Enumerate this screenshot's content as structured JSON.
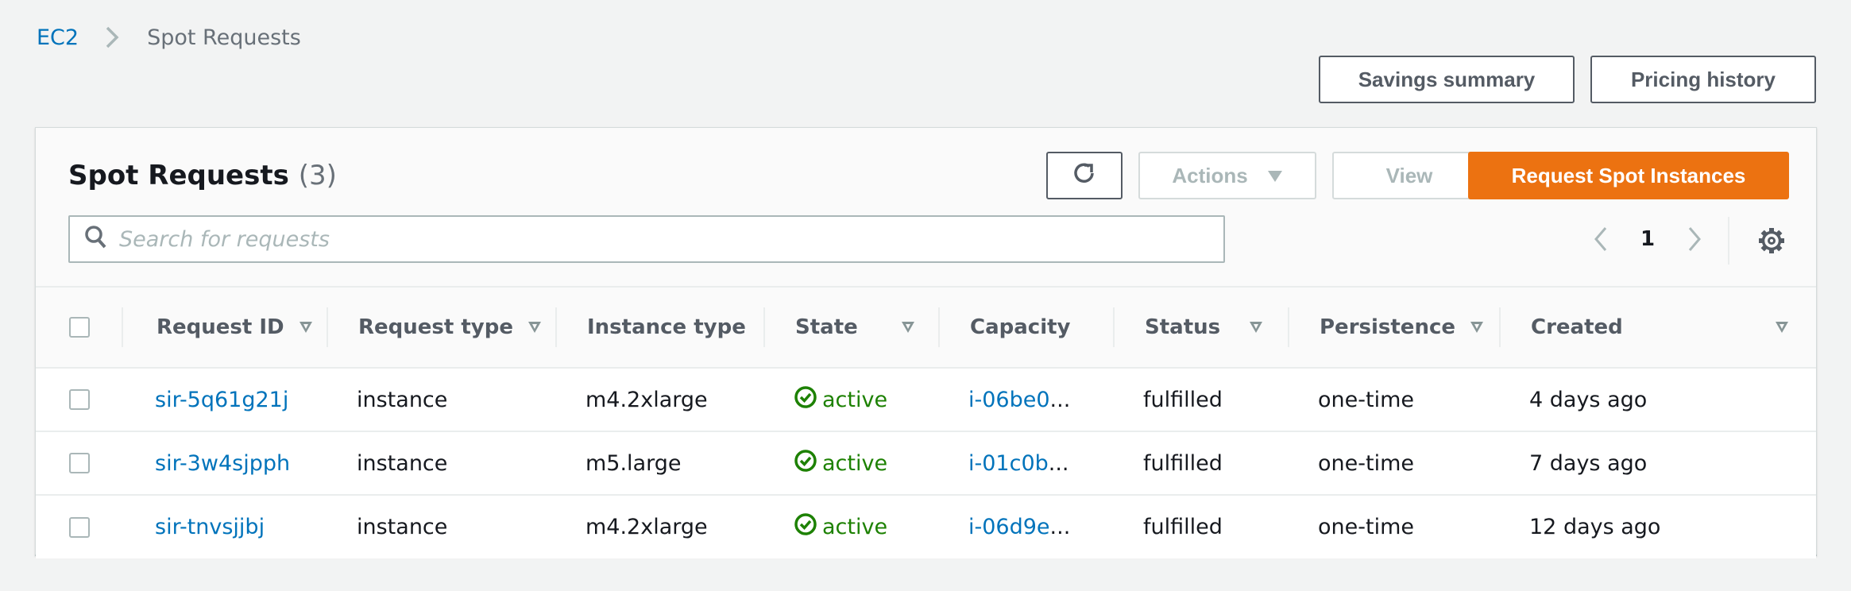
{
  "breadcrumb": {
    "root": "EC2",
    "current": "Spot Requests"
  },
  "top_buttons": {
    "savings_summary": "Savings summary",
    "pricing_history": "Pricing history"
  },
  "panel": {
    "title": "Spot Requests",
    "count": "(3)",
    "actions_label": "Actions",
    "view_label": "View",
    "request_label": "Request Spot Instances",
    "search_placeholder": "Search for requests",
    "search_value": "",
    "page": "1",
    "accent_color": "#ec7211"
  },
  "table": {
    "columns": [
      {
        "label": "Request ID",
        "sortable": true
      },
      {
        "label": "Request type",
        "sortable": true
      },
      {
        "label": "Instance type",
        "sortable": false
      },
      {
        "label": "State",
        "sortable": true
      },
      {
        "label": "Capacity",
        "sortable": false
      },
      {
        "label": "Status",
        "sortable": true
      },
      {
        "label": "Persistence",
        "sortable": true
      },
      {
        "label": "Created",
        "sortable": true
      }
    ],
    "rows": [
      {
        "request_id": "sir-5q61g21j",
        "request_type": "instance",
        "instance_type": "m4.2xlarge",
        "state": "active",
        "capacity": "i-06be0",
        "status": "fulfilled",
        "persistence": "one-time",
        "created": "4 days ago"
      },
      {
        "request_id": "sir-3w4sjpph",
        "request_type": "instance",
        "instance_type": "m5.large",
        "state": "active",
        "capacity": "i-01c0b",
        "status": "fulfilled",
        "persistence": "one-time",
        "created": "7 days ago"
      },
      {
        "request_id": "sir-tnvsjjbj",
        "request_type": "instance",
        "instance_type": "m4.2xlarge",
        "state": "active",
        "capacity": "i-06d9e",
        "status": "fulfilled",
        "persistence": "one-time",
        "created": "12 days ago"
      }
    ],
    "ellipsis": "..."
  }
}
